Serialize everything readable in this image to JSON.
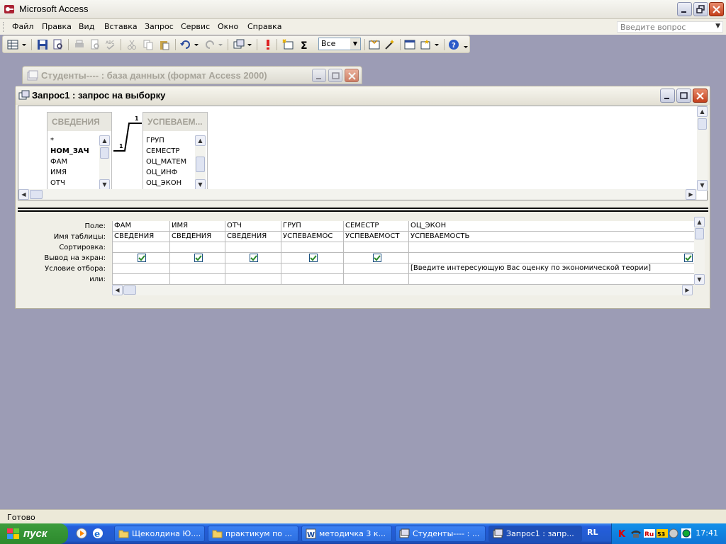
{
  "app": {
    "title": "Microsoft Access"
  },
  "menu": {
    "items": [
      "Файл",
      "Правка",
      "Вид",
      "Вставка",
      "Запрос",
      "Сервис",
      "Окно",
      "Справка"
    ],
    "ask_placeholder": "Введите вопрос"
  },
  "toolbar": {
    "top_values": "Все"
  },
  "db_window": {
    "title": "Студенты---- : база данных (формат Access 2000)"
  },
  "query_window": {
    "title": "Запрос1 : запрос на выборку"
  },
  "tables": [
    {
      "name": "СВЕДЕНИЯ",
      "fields": [
        "*",
        "НОМ_ЗАЧ",
        "ФАМ",
        "ИМЯ",
        "ОТЧ"
      ]
    },
    {
      "name": "УСПЕВАЕМ...",
      "fields": [
        "ГРУП",
        "СЕМЕСТР",
        "ОЦ_МАТЕМ",
        "ОЦ_ИНФ",
        "ОЦ_ЭКОН"
      ]
    }
  ],
  "relation": {
    "left": "1",
    "right": "1"
  },
  "grid": {
    "row_labels": [
      "Поле:",
      "Имя таблицы:",
      "Сортировка:",
      "Вывод на экран:",
      "Условие отбора:",
      "или:"
    ],
    "columns": [
      {
        "field": "ФАМ",
        "table": "СВЕДЕНИЯ",
        "show": true,
        "criteria": ""
      },
      {
        "field": "ИМЯ",
        "table": "СВЕДЕНИЯ",
        "show": true,
        "criteria": ""
      },
      {
        "field": "ОТЧ",
        "table": "СВЕДЕНИЯ",
        "show": true,
        "criteria": ""
      },
      {
        "field": "ГРУП",
        "table": "УСПЕВАЕМОС",
        "show": true,
        "criteria": ""
      },
      {
        "field": "СЕМЕСТР",
        "table": "УСПЕВАЕМОСТ",
        "show": true,
        "criteria": ""
      },
      {
        "field": "ОЦ_ЭКОН",
        "table": "УСПЕВАЕМОСТЬ",
        "show": true,
        "criteria": "[Введите интересующую Вас оценку по экономической теории]"
      }
    ]
  },
  "status": {
    "text": "Готово"
  },
  "taskbar": {
    "start_label": "пуск",
    "tasks": [
      "Щеколдина Ю....",
      "практикум по ...",
      "методичка 3 к...",
      "Студенты---- : ...",
      "Запрос1 : запр..."
    ],
    "lang": "RL",
    "clock": "17:41"
  },
  "colors": {
    "desktop": "#9c9cb5",
    "taskbar": "#245edc",
    "start": "#2d8a2d",
    "check": "#2a8a2a"
  }
}
